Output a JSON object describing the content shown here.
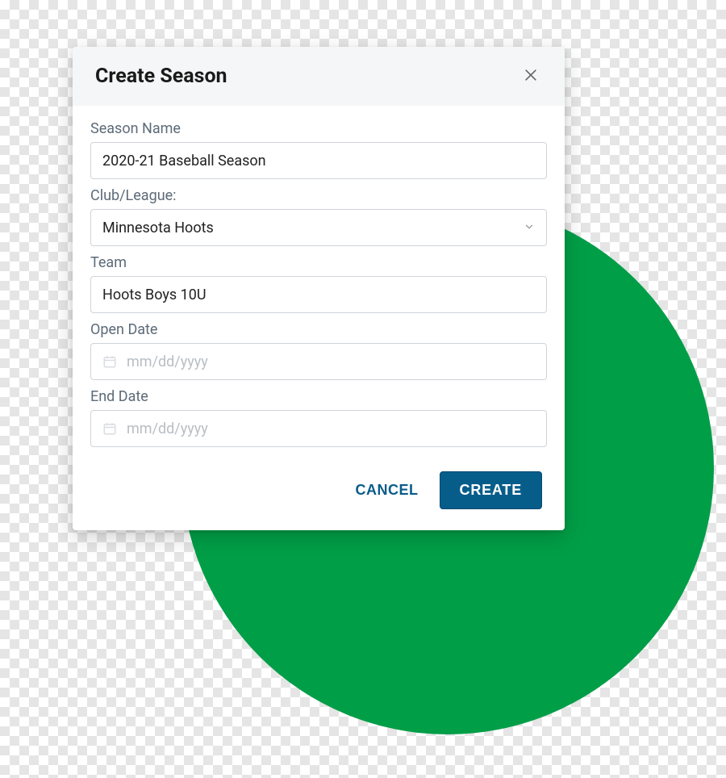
{
  "modal": {
    "title": "Create Season",
    "fields": {
      "season_name": {
        "label": "Season Name",
        "value": "2020-21 Baseball Season"
      },
      "club_league": {
        "label": "Club/League:",
        "value": "Minnesota Hoots"
      },
      "team": {
        "label": "Team",
        "value": "Hoots Boys 10U"
      },
      "open_date": {
        "label": "Open Date",
        "placeholder": "mm/dd/yyyy"
      },
      "end_date": {
        "label": "End Date",
        "placeholder": "mm/dd/yyyy"
      }
    },
    "buttons": {
      "cancel": "CANCEL",
      "create": "CREATE"
    }
  }
}
